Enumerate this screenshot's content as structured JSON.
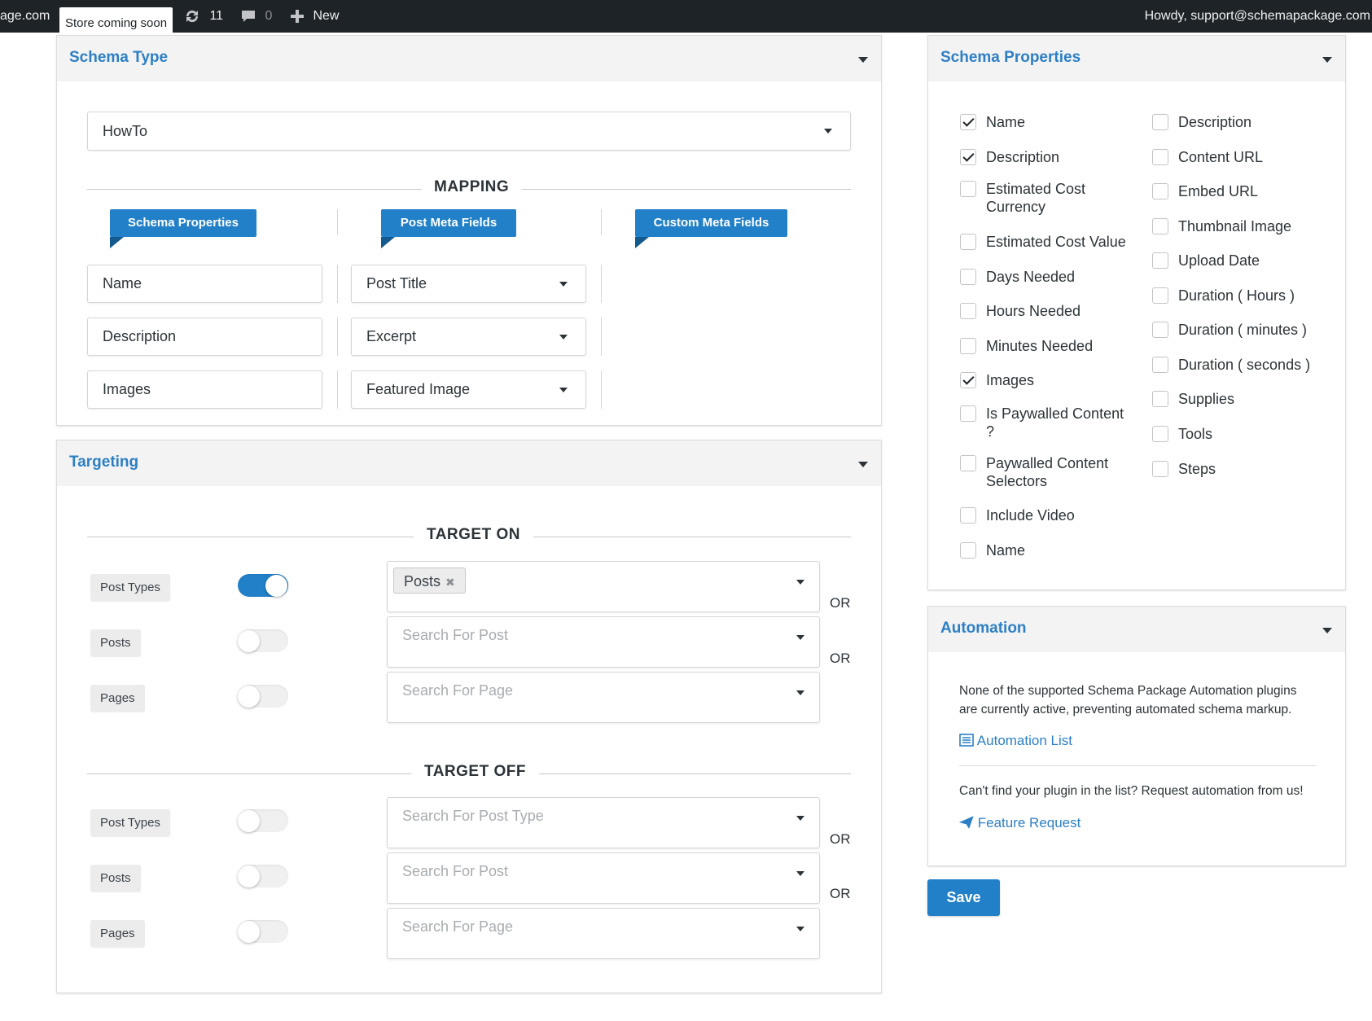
{
  "adminbar": {
    "site": "age.com",
    "store_badge": "Store coming soon",
    "updates_count": "11",
    "comments_count": "0",
    "new_label": "New",
    "howdy": "Howdy, support@schemapackage.com"
  },
  "schema_type": {
    "title": "Schema Type",
    "selected": "HowTo",
    "mapping_label": "MAPPING",
    "ribbons": [
      "Schema Properties",
      "Post Meta Fields",
      "Custom Meta Fields"
    ],
    "rows": [
      {
        "property": "Name",
        "field": "Post Title"
      },
      {
        "property": "Description",
        "field": "Excerpt"
      },
      {
        "property": "Images",
        "field": "Featured Image"
      }
    ]
  },
  "targeting": {
    "title": "Targeting",
    "target_on_label": "TARGET ON",
    "target_off_label": "TARGET OFF",
    "or_label": "OR",
    "on_rows": [
      {
        "label": "Post Types",
        "enabled": true,
        "chip": "Posts",
        "placeholder": ""
      },
      {
        "label": "Posts",
        "enabled": false,
        "placeholder": "Search For Post"
      },
      {
        "label": "Pages",
        "enabled": false,
        "placeholder": "Search For Page"
      }
    ],
    "off_rows": [
      {
        "label": "Post Types",
        "enabled": false,
        "placeholder": "Search For Post Type"
      },
      {
        "label": "Posts",
        "enabled": false,
        "placeholder": "Search For Post"
      },
      {
        "label": "Pages",
        "enabled": false,
        "placeholder": "Search For Page"
      }
    ]
  },
  "schema_properties": {
    "title": "Schema Properties",
    "left": [
      {
        "label": "Name",
        "checked": true
      },
      {
        "label": "Description",
        "checked": true
      },
      {
        "label": "Estimated Cost Currency",
        "checked": false
      },
      {
        "label": "Estimated Cost Value",
        "checked": false
      },
      {
        "label": "Days Needed",
        "checked": false
      },
      {
        "label": "Hours Needed",
        "checked": false
      },
      {
        "label": "Minutes Needed",
        "checked": false
      },
      {
        "label": "Images",
        "checked": true
      },
      {
        "label": "Is Paywalled Content ?",
        "checked": false
      },
      {
        "label": "Paywalled Content Selectors",
        "checked": false
      },
      {
        "label": "Include Video",
        "checked": false
      },
      {
        "label": "Name",
        "checked": false
      }
    ],
    "right": [
      {
        "label": "Description",
        "checked": false
      },
      {
        "label": "Content URL",
        "checked": false
      },
      {
        "label": "Embed URL",
        "checked": false
      },
      {
        "label": "Thumbnail Image",
        "checked": false
      },
      {
        "label": "Upload Date",
        "checked": false
      },
      {
        "label": "Duration ( Hours )",
        "checked": false
      },
      {
        "label": "Duration ( minutes )",
        "checked": false
      },
      {
        "label": "Duration ( seconds )",
        "checked": false
      },
      {
        "label": "Supplies",
        "checked": false
      },
      {
        "label": "Tools",
        "checked": false
      },
      {
        "label": "Steps",
        "checked": false
      }
    ]
  },
  "automation": {
    "title": "Automation",
    "message": "None of the supported Schema Package Automation plugins are currently active, preventing automated schema markup.",
    "list_link": "Automation List",
    "request_text": "Can't find your plugin in the list? Request automation from us!",
    "feature_link": "Feature Request"
  },
  "save_label": "Save",
  "colors": {
    "accent": "#2280c9",
    "title_blue": "#2d7fc5",
    "adminbar": "#1d2327"
  }
}
